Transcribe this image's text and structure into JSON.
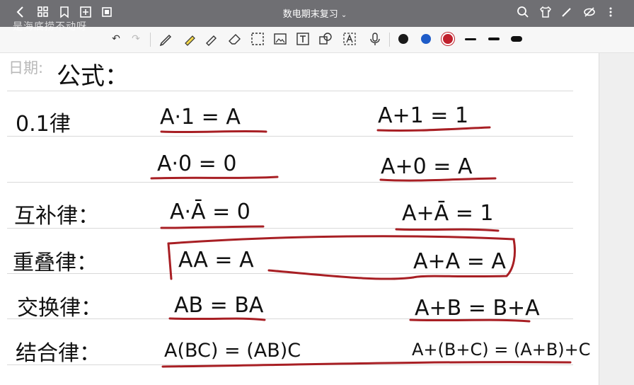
{
  "app": {
    "title": "数电期末复习",
    "banner": "是海底捞不动呀"
  },
  "topbar": {
    "icons": [
      "back-icon",
      "grid-icon",
      "bookmark-icon",
      "add-page-icon",
      "export-icon",
      "search-icon",
      "shirt-icon",
      "pen-icon",
      "hide-icon",
      "more-icon"
    ]
  },
  "toolbar": {
    "tools": [
      "undo-icon",
      "redo-icon",
      "pencil-icon",
      "highlighter-icon",
      "marker-icon",
      "eraser-icon",
      "lasso-icon",
      "image-icon",
      "text-icon",
      "shape-icon",
      "ocr-icon",
      "mic-icon"
    ],
    "colors": [
      "#1a1a1a",
      "#1e5cc8",
      "#c0202c"
    ],
    "selected_color": "#c0202c"
  },
  "note": {
    "date_label": "日期:",
    "heading": "公式：",
    "rows": [
      {
        "law": "0.1律",
        "left": "A·1 = A",
        "right": "A+1 = 1"
      },
      {
        "law": "",
        "left": "A·0 = 0",
        "right": "A+0 = A"
      },
      {
        "law": "互补律：",
        "left": "A·Ā = 0",
        "right": "A+Ā = 1"
      },
      {
        "law": "重叠律：",
        "left": "AA = A",
        "right": "A+A = A"
      },
      {
        "law": "交换律：",
        "left": "AB = BA",
        "right": "A+B = B+A"
      },
      {
        "law": "结合律：",
        "left": "A(BC) = (AB)C",
        "right": "A+(B+C) = (A+B)+C"
      }
    ]
  }
}
